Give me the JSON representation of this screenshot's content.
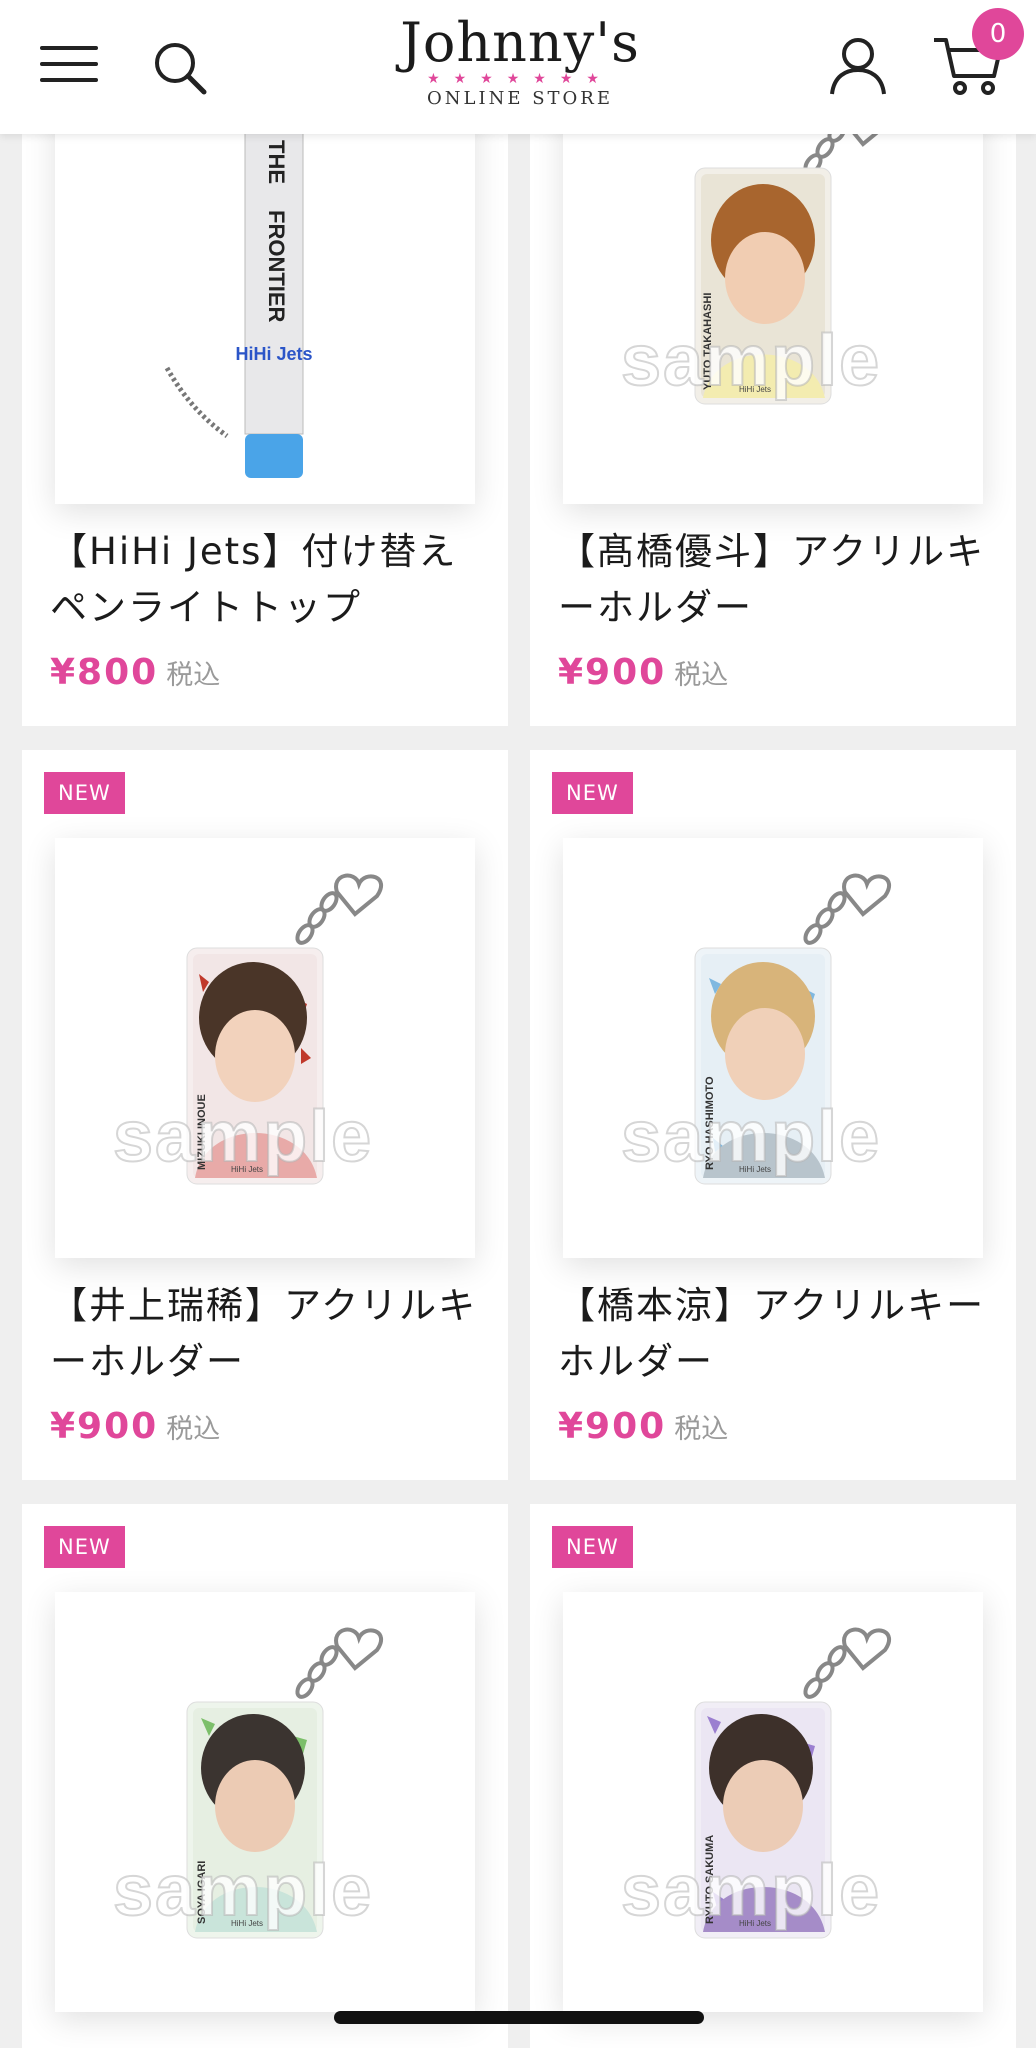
{
  "header": {
    "menu_icon": "hamburger-menu-icon",
    "search_icon": "search-icon",
    "logo_text": "Johnny's",
    "logo_subtext": "ONLINE STORE",
    "account_icon": "user-icon",
    "cart_icon": "cart-icon",
    "cart_count": "0"
  },
  "colors": {
    "accent": "#e0479a",
    "background": "#efefef",
    "card": "#ffffff"
  },
  "products": [
    {
      "title": "【HiHi Jets】付け替えペンライトトップ",
      "price": "¥800",
      "tax_label": "税込",
      "badge": ""
    },
    {
      "title": "【髙橋優斗】アクリルキーホルダー",
      "price": "¥900",
      "tax_label": "税込",
      "badge": ""
    },
    {
      "title": "【井上瑞稀】アクリルキーホルダー",
      "price": "¥900",
      "tax_label": "税込",
      "badge": "NEW"
    },
    {
      "title": "【橋本涼】アクリルキーホルダー",
      "price": "¥900",
      "tax_label": "税込",
      "badge": "NEW"
    },
    {
      "title": "",
      "price": "",
      "tax_label": "",
      "badge": "NEW"
    },
    {
      "title": "",
      "price": "",
      "tax_label": "",
      "badge": "NEW"
    }
  ],
  "watermark": "sample",
  "product_images": [
    {
      "print_lines": [
        "THE",
        "FRONTIER"
      ],
      "brand": "HiHi Jets"
    },
    {
      "card_caption": "YUTO TAKAHASHI",
      "group": "HiHi Jets"
    },
    {
      "card_caption": "MIZUKI INOUE",
      "group": "HiHi Jets"
    },
    {
      "card_caption": "RYO HASHIMOTO",
      "group": "HiHi Jets"
    },
    {
      "card_caption": "SOYA IGARI",
      "group": "HiHi Jets"
    },
    {
      "card_caption": "RYUTO SAKUMA",
      "group": "HiHi Jets"
    }
  ]
}
